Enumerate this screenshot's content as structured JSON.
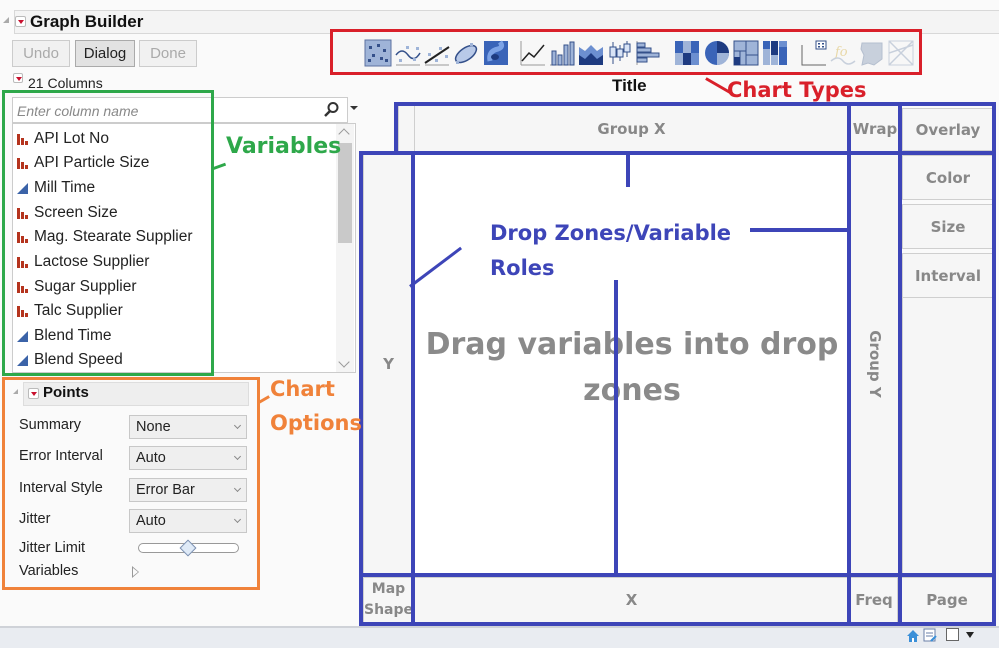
{
  "header": {
    "title": "Graph Builder",
    "buttons": [
      {
        "label": "Undo",
        "state": "disabled"
      },
      {
        "label": "Dialog",
        "state": "active"
      },
      {
        "label": "Done",
        "state": "disabled"
      }
    ]
  },
  "columns": {
    "count_label": "21 Columns",
    "search_placeholder": "Enter column name",
    "items": [
      {
        "name": "API Lot No",
        "type": "nominal"
      },
      {
        "name": "API Particle Size",
        "type": "nominal"
      },
      {
        "name": "Mill Time",
        "type": "continuous"
      },
      {
        "name": "Screen Size",
        "type": "nominal"
      },
      {
        "name": "Mag. Stearate Supplier",
        "type": "nominal"
      },
      {
        "name": "Lactose Supplier",
        "type": "nominal"
      },
      {
        "name": "Sugar Supplier",
        "type": "nominal"
      },
      {
        "name": "Talc Supplier",
        "type": "nominal"
      },
      {
        "name": "Blend Time",
        "type": "continuous"
      },
      {
        "name": "Blend Speed",
        "type": "continuous"
      }
    ]
  },
  "points_panel": {
    "title": "Points",
    "options": [
      {
        "label": "Summary",
        "value": "None"
      },
      {
        "label": "Error Interval",
        "value": "Auto"
      },
      {
        "label": "Interval Style",
        "value": "Error Bar"
      },
      {
        "label": "Jitter",
        "value": "Auto"
      }
    ],
    "jitter_limit_label": "Jitter Limit",
    "jitter_limit_fraction": 0.5,
    "variables_label": "Variables"
  },
  "chart_types": [
    {
      "name": "points",
      "selected": true
    },
    {
      "name": "smoother"
    },
    {
      "name": "line-of-fit"
    },
    {
      "name": "ellipse"
    },
    {
      "name": "contour"
    },
    {
      "name": "line"
    },
    {
      "name": "bar"
    },
    {
      "name": "area"
    },
    {
      "name": "box-plot"
    },
    {
      "name": "histogram"
    },
    {
      "name": "heatmap"
    },
    {
      "name": "pie"
    },
    {
      "name": "treemap"
    },
    {
      "name": "mosaic"
    },
    {
      "name": "caption-box"
    },
    {
      "name": "formula",
      "disabled": true
    },
    {
      "name": "map-shapes",
      "disabled": true
    },
    {
      "name": "parallel",
      "disabled": true
    }
  ],
  "graph": {
    "title": "Title",
    "message": "Drag variables into drop zones"
  },
  "drop_zones": {
    "group_x": "Group X",
    "wrap": "Wrap",
    "overlay": "Overlay",
    "color": "Color",
    "size": "Size",
    "interval": "Interval",
    "y": "Y",
    "group_y": "Group Y",
    "map_shape": "Map Shape",
    "x": "X",
    "freq": "Freq",
    "page": "Page"
  },
  "annotations": {
    "variables": "Variables",
    "chart_options": "Chart Options",
    "chart_types": "Chart Types",
    "drop_zones": "Drop Zones/Variable Roles"
  },
  "colors": {
    "variables_annotation": "#2ea84a",
    "options_annotation": "#f0823a",
    "chart_types_annotation": "#d9202a",
    "drop_zones_annotation": "#3d45b8"
  }
}
